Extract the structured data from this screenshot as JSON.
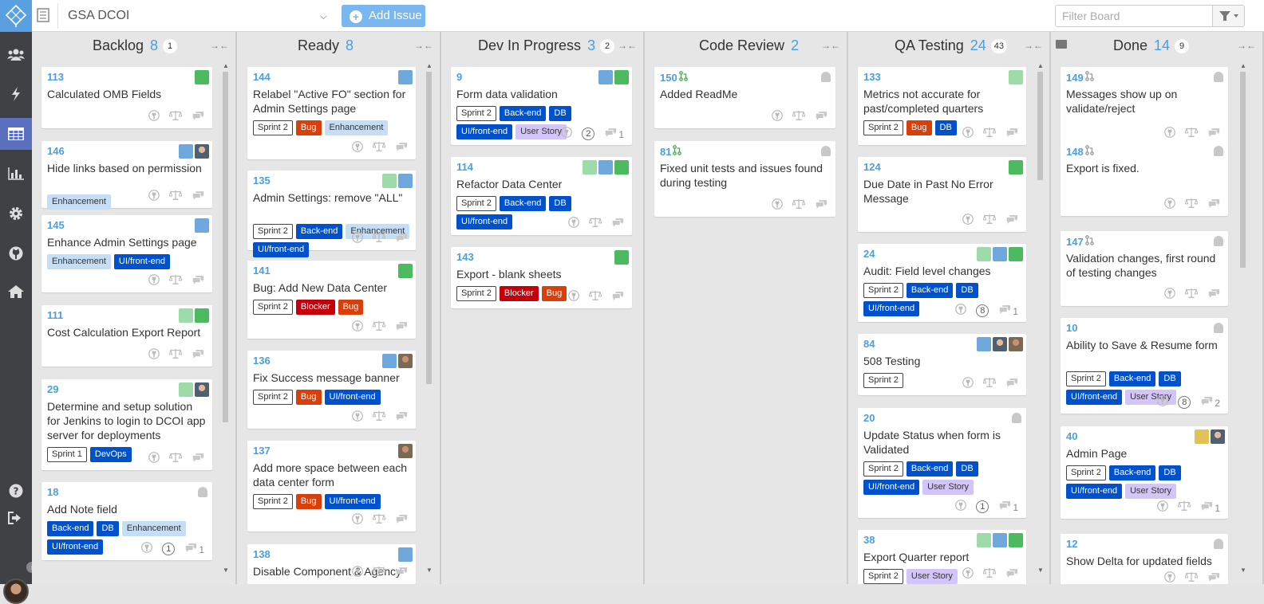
{
  "topbar": {
    "board_name": "GSA DCOI",
    "add_issue_label": "Add Issue",
    "filter_placeholder": "Filter Board"
  },
  "sidebar": {
    "items": [
      "users-icon",
      "bolt-icon",
      "board-icon",
      "chart-icon",
      "gear-icon",
      "github-icon",
      "home-icon",
      "help-icon",
      "logout-icon"
    ],
    "active": "board-icon"
  },
  "colors": {
    "accent": "#4a9fe0",
    "sidebar_bg": "#3f4145",
    "sidebar_active": "#5b6fbf",
    "add_issue_bg": "#79b7ee",
    "label_bug": "#d93f0b",
    "label_blocker": "#c5000b",
    "label_blue": "#0052cc",
    "label_enhancement": "#c5def5",
    "label_user_story": "#d4c5f9"
  },
  "columns": [
    {
      "name": "Backlog",
      "count": "8",
      "badge": "1",
      "cards": [
        {
          "num": "113",
          "title": "Calculated OMB Fields",
          "labels": [],
          "avatars": [
            "g"
          ]
        },
        {
          "num": "146",
          "title": "Hide links based on permission",
          "labels": [
            "Enhancement"
          ],
          "avatars": [
            "w",
            "p"
          ]
        },
        {
          "num": "145",
          "title": "Enhance Admin Settings page",
          "labels": [
            "Enhancement",
            "UI/front-end"
          ],
          "avatars": [
            "w"
          ]
        },
        {
          "num": "111",
          "title": "Cost Calculation Export Report",
          "labels": [],
          "avatars": [
            "gl",
            "g"
          ]
        },
        {
          "num": "29",
          "title": "Determine and setup solution for Jenkins to login to DCOI app server for deployments",
          "labels": [
            "Sprint 1",
            "DevOps"
          ],
          "avatars": [
            "gl",
            "p"
          ]
        },
        {
          "num": "18",
          "title": "Add Note field",
          "labels": [
            "Back-end",
            "DB",
            "Enhancement",
            "UI/front-end"
          ],
          "avatars": [
            "ghost"
          ],
          "circle": "1",
          "comments": "1"
        }
      ]
    },
    {
      "name": "Ready",
      "count": "8",
      "badge": "",
      "cards": [
        {
          "num": "144",
          "title": "Relabel \"Active FO\" section for Admin Settings page",
          "labels": [
            "Sprint 2",
            "Bug",
            "Enhancement"
          ],
          "avatars": [
            "w"
          ]
        },
        {
          "num": "135",
          "title": "Admin Settings: remove \"ALL\"",
          "labels": [
            "Sprint 2",
            "Back-end",
            "Enhancement",
            "UI/front-end"
          ],
          "avatars": [
            "gl",
            "w"
          ]
        },
        {
          "num": "141",
          "title": "Bug: Add New Data Center",
          "labels": [
            "Sprint 2",
            "Blocker",
            "Bug"
          ],
          "avatars": [
            "g"
          ]
        },
        {
          "num": "136",
          "title": "Fix Success message banner",
          "labels": [
            "Sprint 2",
            "Bug",
            "UI/front-end"
          ],
          "avatars": [
            "w",
            "q"
          ]
        },
        {
          "num": "137",
          "title": "Add more space between each data center form",
          "labels": [
            "Sprint 2",
            "Bug",
            "UI/front-end"
          ],
          "avatars": [
            "q"
          ]
        },
        {
          "num": "138",
          "title": "Disable Component & Agency",
          "labels": [],
          "avatars": [
            "w"
          ]
        }
      ]
    },
    {
      "name": "Dev In Progress",
      "count": "3",
      "badge": "2",
      "cards": [
        {
          "num": "9",
          "title": "Form data validation",
          "labels": [
            "Sprint 2",
            "Back-end",
            "DB",
            "UI/front-end",
            "User Story"
          ],
          "avatars": [
            "w",
            "g"
          ],
          "circle": "2",
          "comments": "1"
        },
        {
          "num": "114",
          "title": "Refactor Data Center",
          "labels": [
            "Sprint 2",
            "Back-end",
            "DB",
            "UI/front-end"
          ],
          "avatars": [
            "gl",
            "w",
            "g"
          ]
        },
        {
          "num": "143",
          "title": "Export - blank sheets",
          "labels": [
            "Sprint 2",
            "Blocker",
            "Bug"
          ],
          "avatars": [
            "g"
          ]
        }
      ]
    },
    {
      "name": "Code Review",
      "count": "2",
      "badge": "",
      "cards": [
        {
          "num": "150",
          "pr": true,
          "title": "Added ReadMe",
          "labels": [],
          "avatars": [
            "ghost"
          ]
        },
        {
          "num": "81",
          "pr": true,
          "title": "Fixed unit tests and issues found during testing",
          "labels": [],
          "avatars": [
            "ghost"
          ]
        }
      ]
    },
    {
      "name": "QA Testing",
      "count": "24",
      "badge": "43",
      "cards": [
        {
          "num": "133",
          "title": "Metrics not accurate for past/completed quarters",
          "labels": [
            "Sprint 2",
            "Bug",
            "DB"
          ],
          "avatars": [
            "gl"
          ]
        },
        {
          "num": "124",
          "title": "Due Date in Past No Error Message",
          "labels": [],
          "avatars": [
            "g"
          ]
        },
        {
          "num": "24",
          "title": "Audit: Field level changes",
          "labels": [
            "Sprint 2",
            "Back-end",
            "DB",
            "UI/front-end"
          ],
          "avatars": [
            "gl",
            "w",
            "g"
          ],
          "circle": "8",
          "comments": "1"
        },
        {
          "num": "84",
          "title": "508 Testing",
          "labels": [
            "Sprint 2"
          ],
          "avatars": [
            "w",
            "p",
            "q"
          ]
        },
        {
          "num": "20",
          "title": "Update Status when form is Validated",
          "labels": [
            "Sprint 2",
            "Back-end",
            "DB",
            "UI/front-end",
            "User Story"
          ],
          "avatars": [
            "ghost"
          ],
          "circle": "1",
          "comments": "1"
        },
        {
          "num": "38",
          "title": "Export Quarter report",
          "labels": [
            "Sprint 2",
            "User Story"
          ],
          "avatars": [
            "gl",
            "w",
            "g"
          ]
        }
      ]
    },
    {
      "name": "Done",
      "count": "14",
      "badge": "9",
      "cards": [
        {
          "num": "149",
          "pr": true,
          "title": "Messages show up on validate/reject",
          "labels": [],
          "avatars": [
            "ghost"
          ]
        },
        {
          "num": "148",
          "pr": true,
          "title": "Export is fixed.",
          "labels": [],
          "avatars": [
            "ghost"
          ]
        },
        {
          "num": "147",
          "pr": true,
          "title": "Validation changes, first round of testing changes",
          "labels": [],
          "avatars": [
            "ghost"
          ]
        },
        {
          "num": "10",
          "title": "Ability to Save & Resume form",
          "labels": [
            "Sprint 2",
            "Back-end",
            "DB",
            "UI/front-end",
            "User Story"
          ],
          "avatars": [
            "ghost"
          ],
          "circle": "8",
          "comments": "2"
        },
        {
          "num": "40",
          "title": "Admin Page",
          "labels": [
            "Sprint 2",
            "Back-end",
            "DB",
            "UI/front-end",
            "User Story"
          ],
          "avatars": [
            "y",
            "p"
          ],
          "comments": "1"
        },
        {
          "num": "12",
          "title": "Show Delta for updated fields",
          "labels": [],
          "avatars": [
            "ghost"
          ]
        }
      ]
    }
  ]
}
